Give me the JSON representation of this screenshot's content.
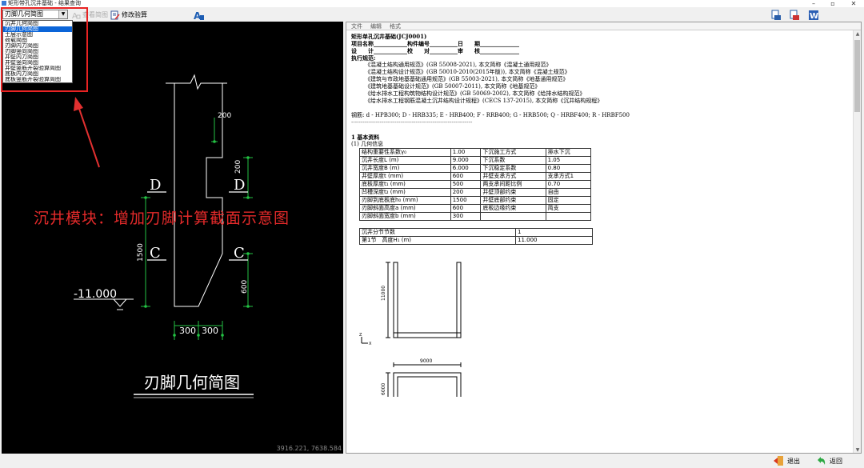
{
  "window": {
    "title": "矩形带孔沉井基础 - 结果查询"
  },
  "toolbar": {
    "view_select_value": "刃脚几何简图",
    "btn_view_label": "查看简图",
    "btn_edit_label": "修改验算"
  },
  "dropdown": {
    "options": [
      "沉井几何简图",
      "刃脚几何简图",
      "土层示意图",
      "荷载简图",
      "刃脚内力简图",
      "刃脚竖向简图",
      "井壁内力简图",
      "井壁竖向简图",
      "井壁竖筋开裂验算简图",
      "底板内力简图",
      "底板竖筋开裂验算简图"
    ],
    "selected_index": 1
  },
  "annotation": "沉井模块：增加刃脚计算截面示意图",
  "drawing": {
    "dim_200": "200",
    "dim_200b": "200",
    "dim_1500": "1500",
    "dim_600": "600",
    "dim_300a": "300",
    "dim_300b": "300",
    "label_D1": "D",
    "label_D2": "D",
    "label_C1": "C",
    "label_C2": "C",
    "elevation": "-11.000",
    "caption": "刃脚几何简图",
    "coord": "3916.221, 7638.584"
  },
  "report_menu": [
    "文件",
    "编辑",
    "格式"
  ],
  "report": {
    "title": "矩形单孔沉井基础(JCJ0001)",
    "meta_line1": "项目名称____________构件编号__________日　　期______________",
    "meta_line2": "设　　计____________校　　对__________审　　核______________",
    "spec_title": "执行规范:",
    "specs": [
      "《混凝土结构通用规范》(GB 55008-2021), 本文简称《混凝土通用规范》",
      "《混凝土结构设计规范》(GB 50010-2010(2015年版)), 本文简称《混凝土规范》",
      "《建筑与市政地基基础通用规范》(GB 55003-2021), 本文简称《地基通用规范》",
      "《建筑地基基础设计规范》(GB 50007-2011), 本文简称《地基规范》",
      "《给水排水工程构筑物结构设计规范》(GB 50069-2002), 本文简称《给排水结构规范》",
      "《给水排水工程钢筋混凝土沉井结构设计规程》(CECS 137-2015), 本文简称《沉井结构规程》"
    ],
    "rebar_line": "钢筋: d - HPB300; D - HRB335; E - HRB400; F - RRB400; G - HRB500; Q - HRBF400; R - HRBF500",
    "divider": "----------------------------------------------------------------",
    "section1": "1 基本资料",
    "section1_1": "(1) 几何信息",
    "geo_rows": [
      [
        "结构重要性系数γ₀",
        "1.00",
        "下沉施工方式",
        "排水下沉"
      ],
      [
        "沉井长度L (m)",
        "9.000",
        "下沉系数",
        "1.05"
      ],
      [
        "沉井宽度B (m)",
        "6.000",
        "下沉稳定系数",
        "0.80"
      ],
      [
        "井壁厚度t (mm)",
        "600",
        "井壁支承方式",
        "支承方式1"
      ],
      [
        "底板厚度t₁ (mm)",
        "500",
        "两支承间距比例",
        "0.70"
      ],
      [
        "凹槽深度t₂ (mm)",
        "200",
        "井壁顶部约束",
        "自由"
      ],
      [
        "刃脚到底板底h₀ (mm)",
        "1500",
        "井壁底部约束",
        "固定"
      ],
      [
        "刃脚斜面高度a (mm)",
        "600",
        "底板边缘约束",
        "简支"
      ],
      [
        "刃脚斜面宽度b (mm)",
        "300",
        "",
        ""
      ]
    ],
    "seg_rows": [
      [
        "沉井分节节数",
        "1"
      ],
      [
        "第1节　高度H₁ (m)",
        "11.000"
      ]
    ],
    "fig_dim_11000": "11000",
    "fig_dim_9000": "9000",
    "fig_dim_6000": "6000",
    "axis_z": "Z",
    "axis_x": "X"
  },
  "statusbar": {
    "exit_label": "退出",
    "back_label": "返回"
  }
}
